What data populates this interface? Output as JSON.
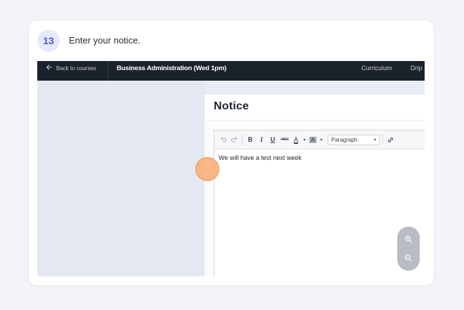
{
  "step": {
    "number": "13",
    "instruction": "Enter your notice."
  },
  "app": {
    "back_link": "Back to courses",
    "course_title": "Business Administration (Wed 1pm)",
    "nav": {
      "curriculum": "Curriculum",
      "drip": "Drip"
    }
  },
  "dialog": {
    "title": "Notice"
  },
  "editor": {
    "bold": "B",
    "italic": "I",
    "underline": "U",
    "strikethrough": "ABC",
    "font_color": "A",
    "highlight": "A",
    "paragraph_select": "Paragraph",
    "content": "We will have a test next week"
  },
  "colors": {
    "accent": "#4e52d8",
    "topbar": "#1c222c",
    "click_indicator": "#fba868"
  },
  "icons": {
    "back": "arrow-left-icon",
    "undo": "undo-icon",
    "redo": "redo-icon",
    "link": "link-icon",
    "zoom_in": "zoom-in-icon",
    "zoom_out": "zoom-out-icon"
  }
}
